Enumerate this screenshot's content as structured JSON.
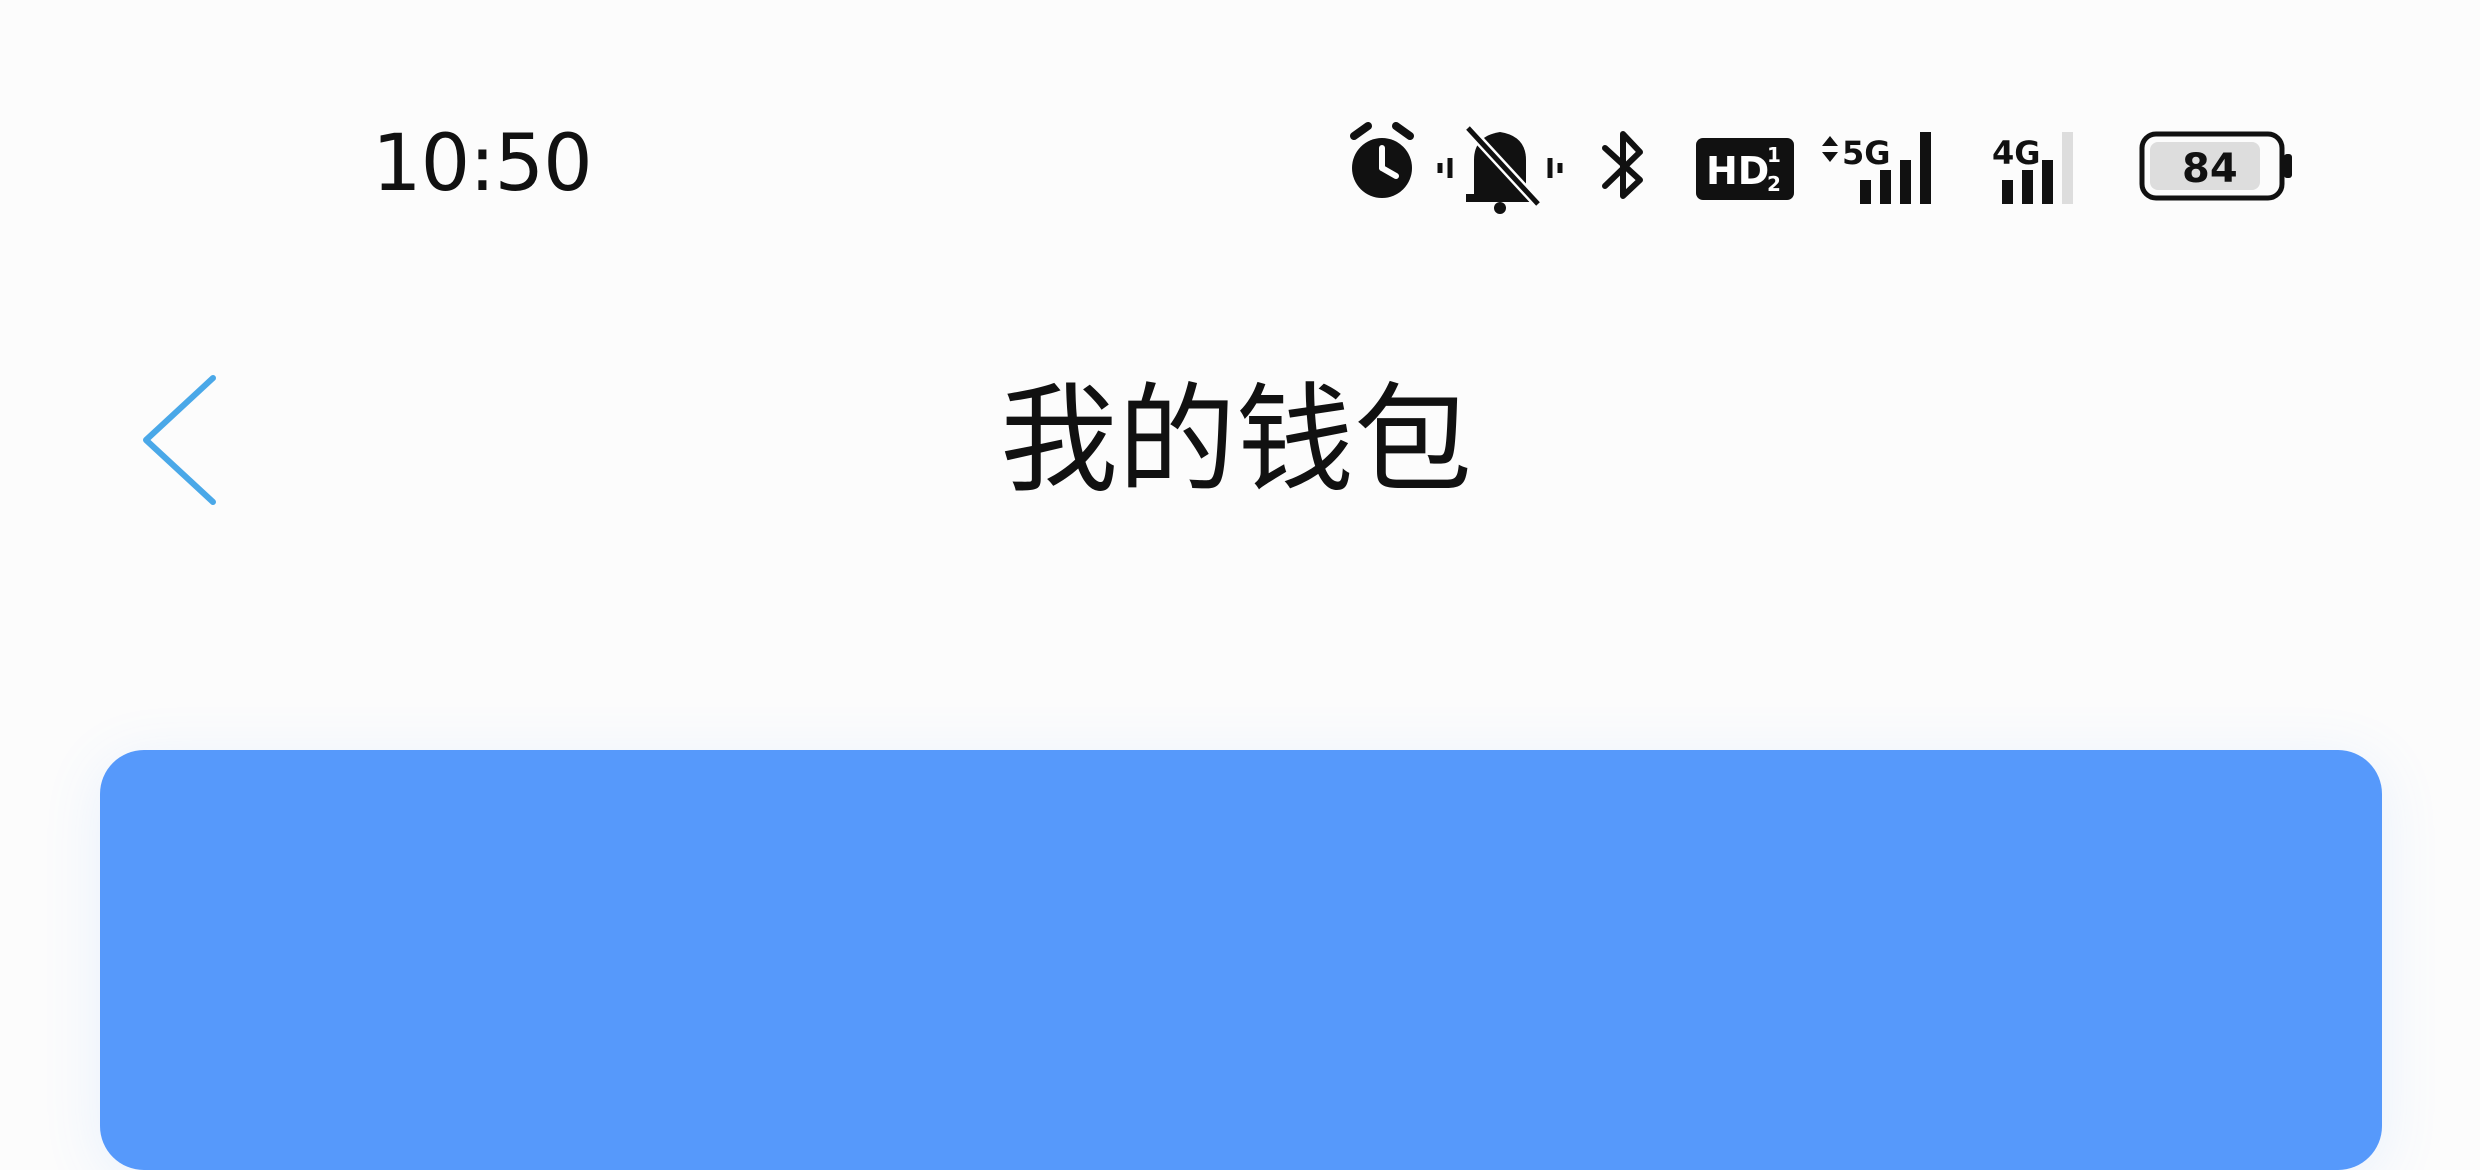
{
  "status_bar": {
    "time": "10:50",
    "icons": [
      "alarm-icon",
      "silent-mode-icon",
      "bluetooth-icon",
      "hd-voice-icon",
      "signal-5g-icon",
      "signal-4g-icon",
      "battery-icon"
    ],
    "hd_label": "HD",
    "hd_sup": "1",
    "hd_sub": "2",
    "network_1": "5G",
    "network_2": "4G",
    "battery_level": "84"
  },
  "header": {
    "title": "我的钱包",
    "back_icon": "chevron-left-icon"
  },
  "colors": {
    "accent": "#4aa8e8",
    "card_bg": "#5699fb",
    "background": "#fcfcfc"
  }
}
